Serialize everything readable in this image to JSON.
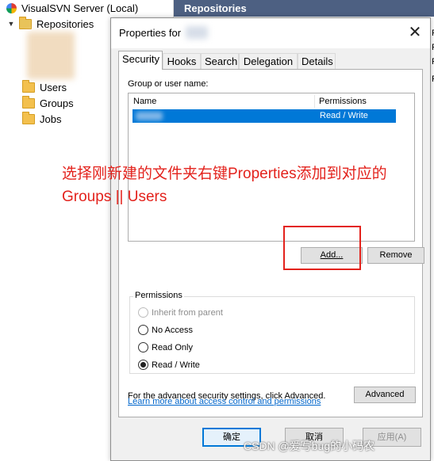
{
  "tree": {
    "server_label": "VisualSVN Server (Local)",
    "repositories_label": "Repositories",
    "items": [
      {
        "label": "Users"
      },
      {
        "label": "Groups"
      },
      {
        "label": "Jobs"
      }
    ]
  },
  "right_pane": {
    "header": "Repositories",
    "edge_letters": [
      "F",
      "F",
      "F",
      "F"
    ]
  },
  "dialog": {
    "title": "Properties for",
    "close_glyph": "✕",
    "tabs": [
      {
        "label": "Security",
        "active": true
      },
      {
        "label": "Hooks"
      },
      {
        "label": "Search"
      },
      {
        "label": "Delegation"
      },
      {
        "label": "Details"
      }
    ],
    "group_label": "Group or user name:",
    "list_columns": [
      "Name",
      "Permissions"
    ],
    "selected_row_permission": "Read / Write",
    "add_button": "Add...",
    "remove_button": "Remove",
    "permissions_group": "Permissions",
    "radios": [
      {
        "label": "Inherit from parent",
        "disabled": true,
        "checked": false
      },
      {
        "label": "No Access",
        "disabled": false,
        "checked": false
      },
      {
        "label": "Read Only",
        "disabled": false,
        "checked": false
      },
      {
        "label": "Read / Write",
        "disabled": false,
        "checked": true
      }
    ],
    "advanced_text": "For the advanced security settings, click Advanced.",
    "advanced_button": "Advanced",
    "help_link": "Learn more about access control and permissions",
    "ok_button": "确定",
    "cancel_button": "取消",
    "apply_button": "应用(A)"
  },
  "annotation": {
    "line1": "选择刚新建的文件夹右键Properties添加到对应的",
    "line2": "Groups || Users",
    "color": "#e3221c"
  },
  "watermark": "CSDN @爱写bug的小码农"
}
